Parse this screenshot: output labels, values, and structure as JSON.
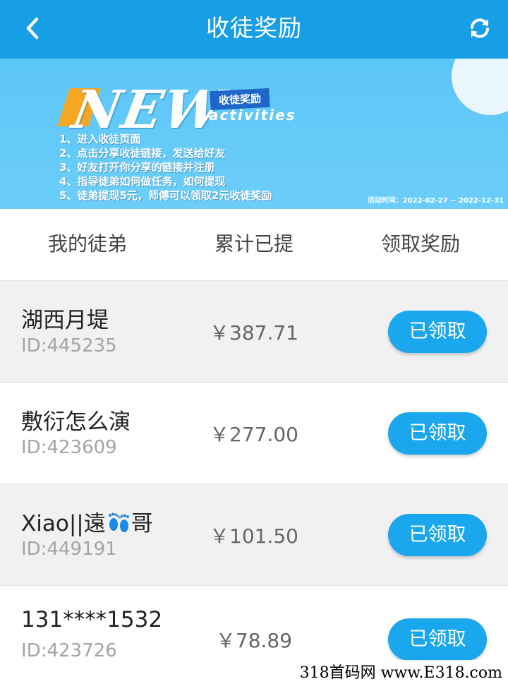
{
  "header": {
    "title": "收徒奖励",
    "back_icon": "chevron-left-icon",
    "refresh_icon": "refresh-icon",
    "bg_color": "#169ee6"
  },
  "banner": {
    "new_text": "NEW",
    "tag": "收徒奖励",
    "activities": "activities",
    "rules": [
      "1、进入收徒页面",
      "2、点击分享收徒链接，发送给好友",
      "3、好友打开你分享的链接并注册",
      "4、指导徒弟如何做任务，如何提现",
      "5、徒弟提现5元，师傅可以领取2元收徒奖励"
    ],
    "period": "活动时间：2022-02-27 ~ 2022-12-31"
  },
  "columns": {
    "apprentice": "我的徒弟",
    "withdrawn": "累计已提",
    "reward": "领取奖励"
  },
  "rows": [
    {
      "name": "湖西月堤",
      "id": "ID:445235",
      "amount": "￥387.71",
      "button": "已领取"
    },
    {
      "name": "敷衍怎么演",
      "id": "ID:423609",
      "amount": "￥277.00",
      "button": "已领取"
    },
    {
      "name_before": "Xiao||遠",
      "name_after": "哥",
      "emoji_icon": "footprints-icon",
      "id": "ID:449191",
      "amount": "￥101.50",
      "button": "已领取"
    },
    {
      "name": "131****1532",
      "id": "ID:423726",
      "amount": "￥78.89",
      "button": "已领取"
    }
  ],
  "watermark": "318首码网 www.E318.com",
  "colors": {
    "accent": "#1aa7ee",
    "row_alt": "#f1f1f1"
  }
}
